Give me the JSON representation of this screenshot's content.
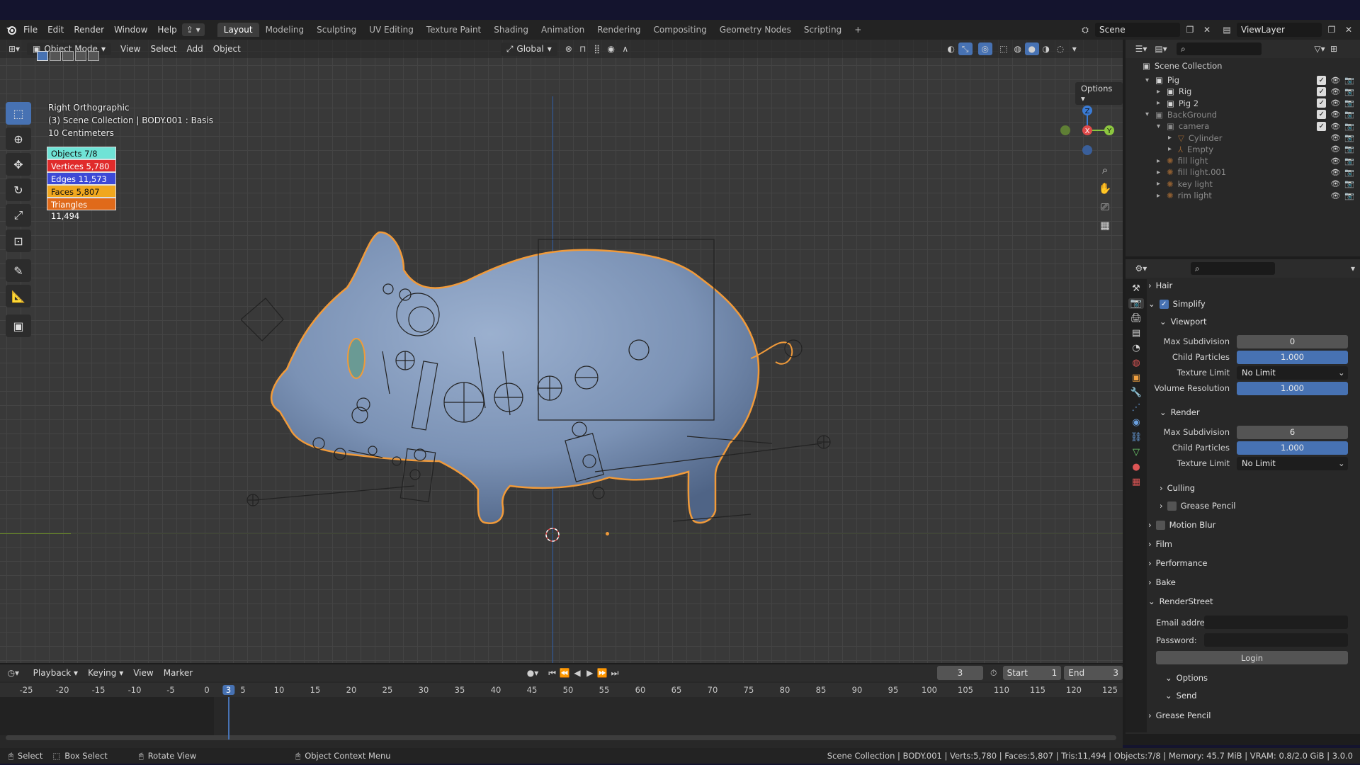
{
  "topbar": {
    "menus": [
      "File",
      "Edit",
      "Render",
      "Window",
      "Help"
    ],
    "workspaces": [
      "Layout",
      "Modeling",
      "Sculpting",
      "UV Editing",
      "Texture Paint",
      "Shading",
      "Animation",
      "Rendering",
      "Compositing",
      "Geometry Nodes",
      "Scripting"
    ],
    "active_workspace": "Layout",
    "add_tab": "+",
    "scene_label": "Scene",
    "viewlayer_label": "ViewLayer"
  },
  "viewport": {
    "mode": "Object Mode",
    "menus": [
      "View",
      "Select",
      "Add",
      "Object"
    ],
    "transform_orientation": "Global",
    "options": "Options",
    "view_name": "Right Orthographic",
    "collection_info": "(3) Scene Collection | BODY.001 : Basis",
    "scale_info": "10 Centimeters",
    "gizmo": {
      "z": "Z",
      "x": "X",
      "y": "Y"
    },
    "stats": [
      {
        "label": "Objects 7/8",
        "color": "#6fe3d6",
        "text_color": "#111"
      },
      {
        "label": "Vertices  5,780",
        "color": "#e02b2b",
        "text_color": "#fff"
      },
      {
        "label": "Edges 11,573",
        "color": "#3c49d6",
        "text_color": "#fff"
      },
      {
        "label": "Faces 5,807",
        "color": "#f0a71e",
        "text_color": "#111"
      },
      {
        "label": "Triangles 11,494",
        "color": "#e06a1a",
        "text_color": "#fff"
      }
    ]
  },
  "outliner": {
    "root": "Scene Collection",
    "rows": [
      {
        "label": "Pig",
        "indent": 1,
        "expanded": true,
        "type": "collection",
        "dim": false
      },
      {
        "label": "Rig",
        "indent": 2,
        "expanded": false,
        "type": "collection",
        "dim": false
      },
      {
        "label": "Pig 2",
        "indent": 2,
        "expanded": false,
        "type": "collection",
        "dim": false
      },
      {
        "label": "BackGround",
        "indent": 1,
        "expanded": true,
        "type": "collection",
        "dim": true
      },
      {
        "label": "camera",
        "indent": 2,
        "expanded": true,
        "type": "collection",
        "dim": true
      },
      {
        "label": "Cylinder",
        "indent": 3,
        "expanded": false,
        "type": "mesh",
        "dim": true
      },
      {
        "label": "Empty",
        "indent": 3,
        "expanded": false,
        "type": "empty",
        "dim": true
      },
      {
        "label": "fill light",
        "indent": 2,
        "expanded": false,
        "type": "light",
        "dim": true
      },
      {
        "label": "fill light.001",
        "indent": 2,
        "expanded": false,
        "type": "light",
        "dim": true
      },
      {
        "label": "key light",
        "indent": 2,
        "expanded": false,
        "type": "light",
        "dim": true
      },
      {
        "label": "rim light",
        "indent": 2,
        "expanded": false,
        "type": "light",
        "dim": true
      }
    ]
  },
  "properties": {
    "hair": "Hair",
    "simplify": "Simplify",
    "viewport_section": "Viewport",
    "viewport_fields": [
      {
        "label": "Max Subdivision",
        "value": "0",
        "style": "gray"
      },
      {
        "label": "Child Particles",
        "value": "1.000",
        "style": "blue"
      },
      {
        "label": "Texture Limit",
        "value": "No Limit",
        "style": "dark"
      },
      {
        "label": "Volume Resolution",
        "value": "1.000",
        "style": "blue"
      }
    ],
    "render_section": "Render",
    "render_fields": [
      {
        "label": "Max Subdivision",
        "value": "6",
        "style": "gray"
      },
      {
        "label": "Child Particles",
        "value": "1.000",
        "style": "blue"
      },
      {
        "label": "Texture Limit",
        "value": "No Limit",
        "style": "dark"
      }
    ],
    "culling": "Culling",
    "grease_pencil_sub": "Grease Pencil",
    "panels": [
      "Motion Blur",
      "Film",
      "Performance",
      "Bake"
    ],
    "renderstreet": "RenderStreet",
    "email_label": "Email addre...",
    "password_label": "Password:",
    "login": "Login",
    "options": "Options",
    "send": "Send",
    "grease_pencil": "Grease Pencil"
  },
  "timeline": {
    "menus": [
      "Playback",
      "Keying",
      "View",
      "Marker"
    ],
    "current_frame": "3",
    "start_label": "Start",
    "start_value": "1",
    "end_label": "End",
    "end_value": "3",
    "ruler": [
      "-25",
      "-20",
      "-15",
      "-10",
      "-5",
      "0",
      "3",
      "5",
      "10",
      "15",
      "20",
      "25",
      "30",
      "35",
      "40",
      "45",
      "50",
      "55",
      "60",
      "65",
      "70",
      "75",
      "80",
      "85",
      "90",
      "95",
      "100",
      "105",
      "110",
      "115",
      "120",
      "125"
    ]
  },
  "statusbar": {
    "select": "Select",
    "box_select": "Box Select",
    "rotate_view": "Rotate View",
    "context_menu": "Object Context Menu",
    "info": "Scene Collection | BODY.001 | Verts:5,780 | Faces:5,807 | Tris:11,494 | Objects:7/8 | Memory: 45.7 MiB | VRAM: 0.8/2.0 GiB | 3.0.0"
  },
  "colors": {
    "accent": "#4772b3",
    "selection_outline": "#f09a3a",
    "pig_body": "#7f96b8"
  }
}
